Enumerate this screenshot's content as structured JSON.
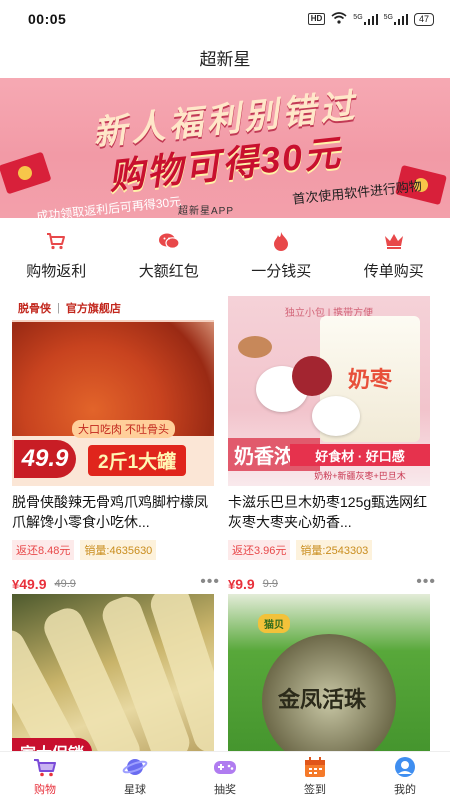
{
  "status_bar": {
    "time": "00:05",
    "hd": "HD",
    "signal_1": "5G",
    "signal_2": "5G",
    "battery": "47"
  },
  "title": "超新星",
  "banner": {
    "line1": "新人福利别错过",
    "line2": "购物可得30元",
    "sub1": "首次使用软件进行购物",
    "sub2": "成功领取返利后可再得30元",
    "logo": "超新星APP"
  },
  "categories": [
    {
      "label": "购物返利",
      "icon": "cart-icon",
      "color": "#e8484a"
    },
    {
      "label": "大额红包",
      "icon": "wechat-icon",
      "color": "#e8484a"
    },
    {
      "label": "一分钱买",
      "icon": "flame-icon",
      "color": "#e8484a"
    },
    {
      "label": "传单购买",
      "icon": "crown-icon",
      "color": "#e8484a"
    }
  ],
  "products": [
    {
      "title": "脱骨侠酸辣无骨鸡爪鸡脚柠檬凤爪解馋小零食小吃休...",
      "rebate": "返还8.48元",
      "sales": "销量:4635630",
      "price_symbol": "¥",
      "price": "49.9",
      "original_price": "49.9",
      "img": {
        "brand": "脱骨侠",
        "store": "官方旗舰店",
        "tag": "大口吃肉 不吐骨头",
        "price": "49.9",
        "promo": "2斤1大罐"
      }
    },
    {
      "title": "卡滋乐巴旦木奶枣125g甄选网红灰枣大枣夹心奶香...",
      "rebate": "返还3.96元",
      "sales": "销量:2543303",
      "price_symbol": "¥",
      "price": "9.9",
      "original_price": "9.9",
      "img": {
        "top": "独立小包 | 携带方便",
        "bag": "奶枣",
        "left": "奶香浓郁",
        "band": "好食材 · 好口感",
        "band2": "奶粉+新疆灰枣+巴旦木"
      }
    },
    {
      "title": "",
      "img": {
        "tag": "家大促销"
      }
    },
    {
      "title": "",
      "img": {
        "badge": "猫贝",
        "label": "金凤活珠"
      }
    }
  ],
  "bottom_nav": [
    {
      "label": "购物",
      "icon": "shopping-bag-icon",
      "active": true
    },
    {
      "label": "星球",
      "icon": "planet-icon",
      "active": false
    },
    {
      "label": "抽奖",
      "icon": "gamepad-icon",
      "active": false
    },
    {
      "label": "签到",
      "icon": "calendar-icon",
      "active": false
    },
    {
      "label": "我的",
      "icon": "profile-icon",
      "active": false
    }
  ]
}
